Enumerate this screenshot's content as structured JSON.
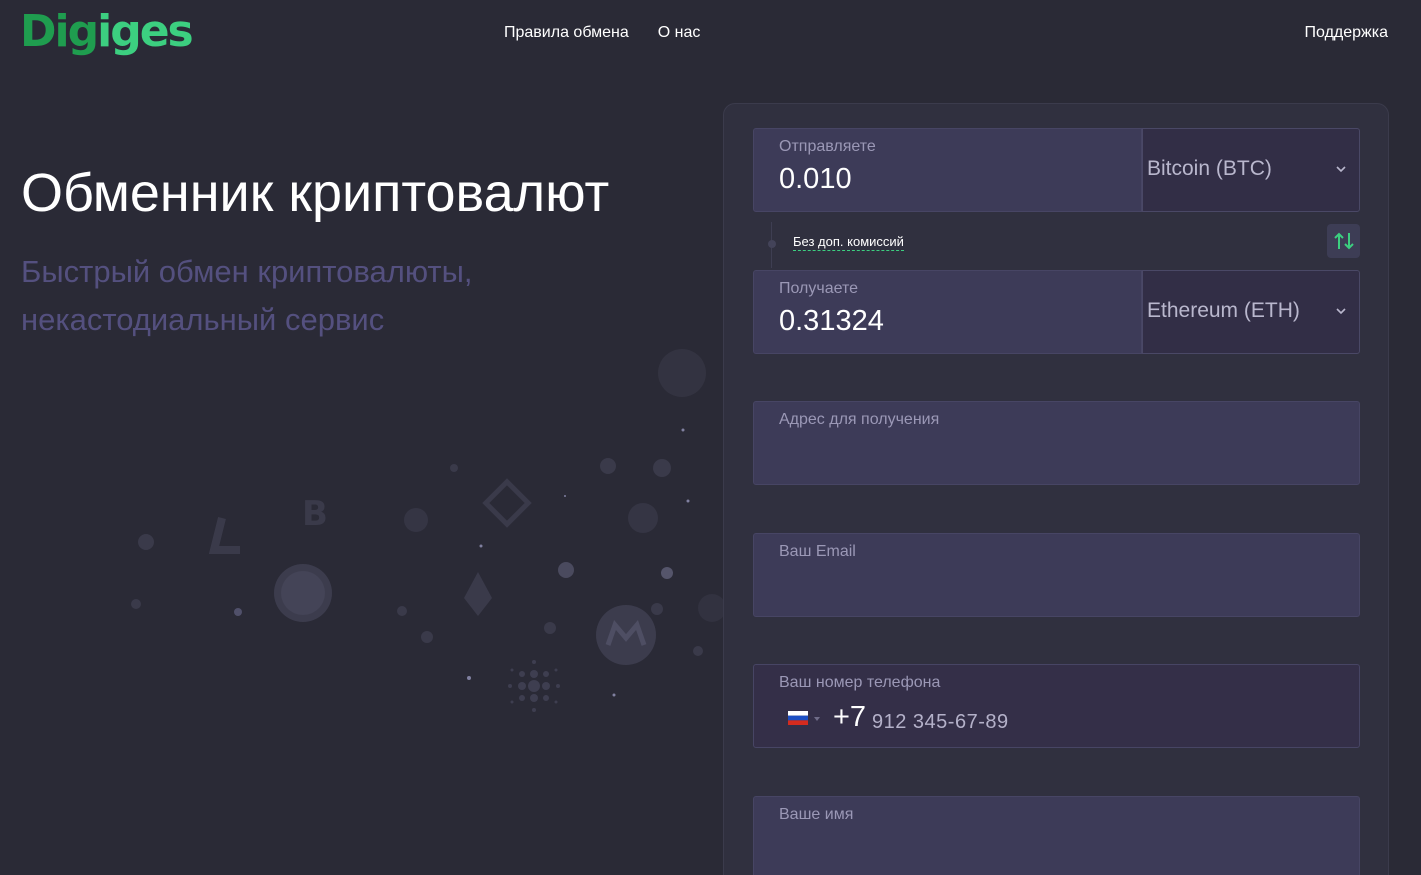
{
  "header": {
    "logo_part1": "Dig",
    "logo_part2": "iges",
    "nav": [
      "Правила обмена",
      "О нас"
    ],
    "support": "Поддержка"
  },
  "hero": {
    "title": "Обменник криптовалют",
    "subtitle": "Быстрый обмен криптовалюты, некастодиальный сервис"
  },
  "form": {
    "send": {
      "label": "Отправляете",
      "value": "0.010",
      "currency": "Bitcoin (BTC)"
    },
    "no_fee": "Без доп. комиссий",
    "receive": {
      "label": "Получаете",
      "value": "0.31324",
      "currency": "Ethereum (ETH)"
    },
    "address": {
      "label": "Адрес для получения"
    },
    "email": {
      "label": "Ваш Email"
    },
    "phone": {
      "label": "Ваш номер телефона",
      "code": "+7",
      "placeholder": "912 345-67-89"
    },
    "name": {
      "label": "Ваше имя"
    }
  },
  "colors": {
    "background": "#2a2a36",
    "card": "#30303f",
    "field": "#3d3b58",
    "accent": "#3ccf80",
    "subtitle": "#54507f"
  }
}
